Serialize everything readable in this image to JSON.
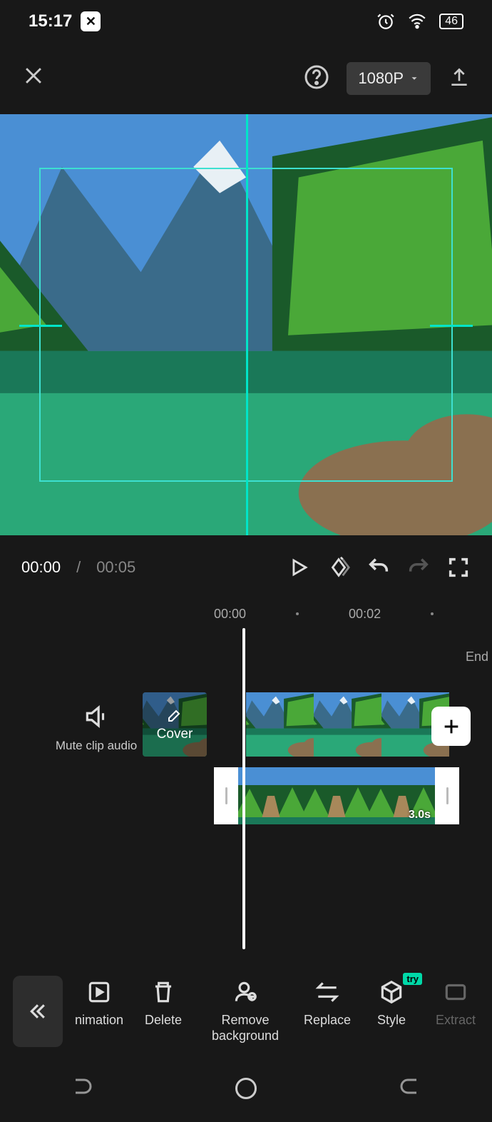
{
  "status": {
    "time": "15:17",
    "battery": "46"
  },
  "topbar": {
    "resolution": "1080P"
  },
  "playback": {
    "current": "00:00",
    "sep": "/",
    "total": "00:05"
  },
  "ruler": {
    "t0": "00:00",
    "t1": "00:02"
  },
  "timeline": {
    "mute_label": "Mute clip audio",
    "cover_label": "Cover",
    "end_label": "End",
    "overlay_duration": "3.0s"
  },
  "tools": {
    "back": "",
    "animation": "nimation",
    "delete": "Delete",
    "remove_bg": "Remove background",
    "replace": "Replace",
    "style": "Style",
    "style_badge": "try",
    "extract": "Extract"
  }
}
